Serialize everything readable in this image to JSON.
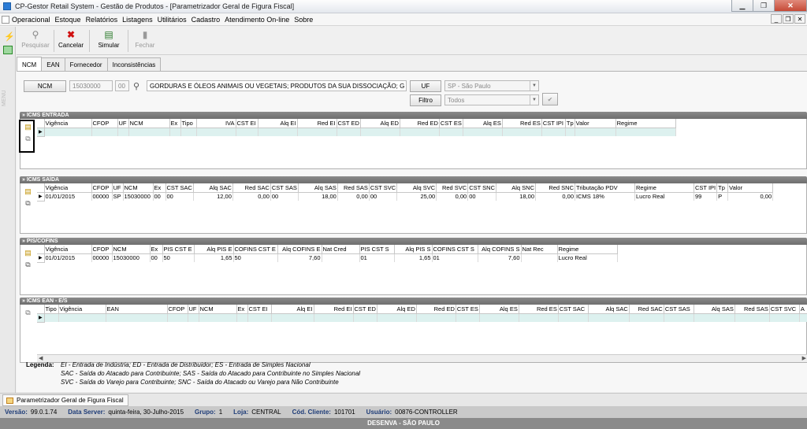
{
  "window": {
    "title": "CP-Gestor Retail System - Gestão de Produtos - [Parametrizador Geral de Figura Fiscal]"
  },
  "menu": [
    "Operacional",
    "Estoque",
    "Relatórios",
    "Listagens",
    "Utilitários",
    "Cadastro",
    "Atendimento On-line",
    "Sobre"
  ],
  "sidebar_vertical_label": "MENU",
  "toolbar": {
    "pesquisar": "Pesquisar",
    "cancelar": "Cancelar",
    "simular": "Simular",
    "fechar": "Fechar"
  },
  "tabs": [
    "NCM",
    "EAN",
    "Fornecedor",
    "Inconsistências"
  ],
  "filter": {
    "ncm_button": "NCM",
    "ncm_value": "15030000",
    "ncm_ex": "00",
    "ncm_description": "GORDURAS E ÓLEOS ANIMAIS OU VEGETAIS; PRODUTOS DA SUA DISSOCIAÇÃO; G",
    "uf_button": "UF",
    "uf_value": "SP - São Paulo",
    "filtro_button": "Filtro",
    "filtro_value": "Todos"
  },
  "icms_entrada": {
    "title": "» ICMS ENTRADA",
    "columns": [
      "Vigência",
      "CFOP",
      "UF",
      "NCM",
      "Ex",
      "Tipo",
      "IVA",
      "CST EI",
      "Alq EI",
      "Red EI",
      "CST ED",
      "Alq ED",
      "Red ED",
      "CST ES",
      "Alq ES",
      "Red ES",
      "CST IPI",
      "Tp",
      "Valor",
      "Regime"
    ]
  },
  "icms_saida": {
    "title": "» ICMS SAÍDA",
    "columns": [
      "Vigência",
      "CFOP",
      "UF",
      "NCM",
      "Ex",
      "CST SAC",
      "Alq SAC",
      "Red SAC",
      "CST SAS",
      "Alq SAS",
      "Red SAS",
      "CST SVC",
      "Alq SVC",
      "Red SVC",
      "CST SNC",
      "Alq SNC",
      "Red SNC",
      "Tributação PDV",
      "Regime",
      "CST IPI",
      "Tp",
      "Valor"
    ],
    "rows": [
      [
        "01/01/2015",
        "00000",
        "SP",
        "15030000",
        "00",
        "00",
        "12,00",
        "0,00",
        "00",
        "18,00",
        "0,00",
        "00",
        "25,00",
        "0,00",
        "00",
        "18,00",
        "0,00",
        "ICMS 18%",
        "Lucro Real",
        "99",
        "P",
        "0,00"
      ]
    ]
  },
  "pis_cofins": {
    "title": "» PIS/COFINS",
    "columns": [
      "Vigência",
      "CFOP",
      "NCM",
      "Ex",
      "PIS CST E",
      "Alq PIS E",
      "COFINS CST E",
      "Alq COFINS E",
      "Nat Cred",
      "PIS CST S",
      "Alq PIS S",
      "COFINS CST S",
      "Alq COFINS S",
      "Nat Rec",
      "Regime"
    ],
    "rows": [
      [
        "01/01/2015",
        "00000",
        "15030000",
        "00",
        "50",
        "1,65",
        "50",
        "7,60",
        "",
        "01",
        "1,65",
        "01",
        "7,60",
        "",
        "Lucro Real"
      ]
    ]
  },
  "icms_ean": {
    "title": "» ICMS EAN - E/S",
    "columns": [
      "Tipo",
      "Vigência",
      "EAN",
      "CFOP",
      "UF",
      "NCM",
      "Ex",
      "CST EI",
      "Alq EI",
      "Red EI",
      "CST ED",
      "Alq ED",
      "Red ED",
      "CST ES",
      "Alq ES",
      "Red ES",
      "CST SAC",
      "Alq SAC",
      "Red SAC",
      "CST SAS",
      "Alq SAS",
      "Red SAS",
      "CST SVC",
      "A"
    ]
  },
  "legend": {
    "label": "Legenda:",
    "lines": [
      "EI - Entrada de Indústria;  ED - Entrada de Distribuidor;  ES - Entrada de Simples Nacional",
      "SAC - Saída do Atacado para Contribuinte;  SAS - Saída do Atacado para Contribuinte no Simples Nacional",
      "SVC - Saída do Varejo para Contribuinte;  SNC - Saída do Atacado ou Varejo para Não Contribuinte"
    ]
  },
  "taskbar": {
    "window_tab": "Parametrizador Geral de Figura Fiscal"
  },
  "status": {
    "versao_label": "Versão:",
    "versao": "99.0.1.74",
    "data_label": "Data Server:",
    "data": "quinta-feira, 30-Julho-2015",
    "grupo_label": "Grupo:",
    "grupo": "1",
    "loja_label": "Loja:",
    "loja": "CENTRAL",
    "cliente_label": "Cód. Cliente:",
    "cliente": "101701",
    "usuario_label": "Usuário:",
    "usuario": "00876-CONTROLLER"
  },
  "footer": "DESENVA - SÃO PAULO"
}
